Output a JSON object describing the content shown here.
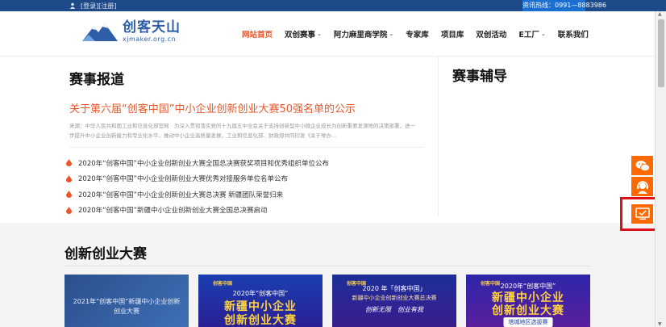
{
  "topbar": {
    "login": "[登录]",
    "register": "[注册]",
    "hotline": "资讯热线：0991—8883986"
  },
  "logo": {
    "name_cn": "创客天山",
    "domain": "xjmaker.org.cn"
  },
  "nav": [
    {
      "label": "网站首页",
      "active": true,
      "dropdown": false
    },
    {
      "label": "双创赛事",
      "active": false,
      "dropdown": true
    },
    {
      "label": "阿力麻里商学院",
      "active": false,
      "dropdown": true
    },
    {
      "label": "专家库",
      "active": false,
      "dropdown": false
    },
    {
      "label": "项目库",
      "active": false,
      "dropdown": false
    },
    {
      "label": "双创活动",
      "active": false,
      "dropdown": false
    },
    {
      "label": "E工厂",
      "active": false,
      "dropdown": true
    },
    {
      "label": "联系我们",
      "active": false,
      "dropdown": false
    }
  ],
  "news": {
    "title": "赛事报道",
    "headline": "关于第六届“创客中国”中小企业创新创业大赛50强名单的公示",
    "summary": "来源：中华人民共和国工业和信息化部官网　为深入贯彻落实党的十九届五中全会关于支持创新型中小微企业成长为创新重要发源地的决策部署，进一步提升中小企业创新能力和专业化水平，推动中小企业高质量发展，工业和信息化部、财政部共同印发《关于举办...",
    "items": [
      "2020年“创客中国”中小企业创新创业大赛全国总决赛获奖项目和优秀组织单位公布",
      "2020年“创客中国”中小企业创新创业大赛优秀对接服务单位名单公布",
      "2020年“创客中国”中小企业创新创业大赛总决赛 新疆团队荣誉归来",
      "2020年“创客中国”新疆中小企业创新创业大赛全国总决赛启动"
    ]
  },
  "coaching": {
    "title": "赛事辅导"
  },
  "contests": {
    "title": "创新创业大赛",
    "cards": [
      {
        "caption": "2021年“创客中国”新疆中小企业创新创业大赛"
      },
      {
        "logo": "创客中国",
        "sub": "2020年“创客中国”",
        "big1": "新疆中小企业",
        "big2": "创新创业大赛"
      },
      {
        "logo": "创客中国",
        "sub": "2020 年「创客中国」",
        "sub2": "新疆中小企业创新创业大赛总决赛",
        "tag": "创新无限　创业有我"
      },
      {
        "logo": "创客中国",
        "sub": "2020年“创客中国”",
        "big1": "新疆中小企业",
        "big2": "创新创业大赛",
        "pill": "塔城地区选拔赛"
      }
    ]
  },
  "colors": {
    "accent": "#e8572c",
    "brand": "#2e5ea8",
    "rail": "#ff6a00",
    "topbar": "#1f4a8a"
  },
  "icons": [
    "user-icon",
    "wechat-icon",
    "service-icon",
    "screen-check-icon",
    "flame-bullet-icon",
    "chevron-down-icon"
  ]
}
